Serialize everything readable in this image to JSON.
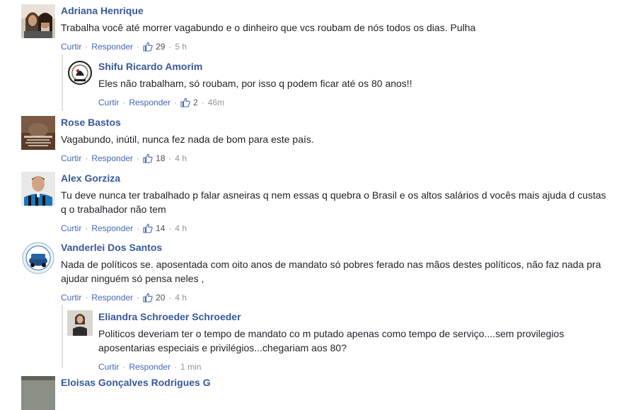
{
  "actions": {
    "like": "Curtir",
    "reply": "Responder",
    "sep": "·"
  },
  "comments": [
    {
      "name": "Adriana Henrique",
      "text": "Trabalha você até morrer vagabundo e o dinheiro que vcs roubam de nós todos os dias. Pulha",
      "likes": "29",
      "time": "5 h"
    },
    {
      "name": "Shifu Ricardo Amorim",
      "text": "Eles não trabalham, só roubam, por isso q podem ficar até os 80 anos!!",
      "likes": "2",
      "time": "46m"
    },
    {
      "name": "Rose Bastos",
      "text": "Vagabundo, inútil, nunca fez nada de bom para este país.",
      "likes": "18",
      "time": "4 h"
    },
    {
      "name": "Alex Gorziza",
      "text": "Tu deve nunca ter trabalhado p falar asneiras q nem essas q quebra o Brasil e os altos salários d vocês mais ajuda d custas q o trabalhador não tem",
      "likes": "14",
      "time": "4 h"
    },
    {
      "name": "Vanderlei Dos Santos",
      "text": "Nada de políticos se. aposentada com oito anos de mandato só pobres ferado nas mãos destes políticos, não faz nada pra ajudar ninguém só pensa neles ,",
      "likes": "20",
      "time": "4 h"
    },
    {
      "name": "Eliandra Schroeder Schroeder",
      "text": "Politicos deveriam ter o tempo de mandato co m putado apenas como tempo de serviço....sem provilegios aposentarias especiais e privilégios...chegariam aos 80?",
      "time": "1 min"
    },
    {
      "name": "Eloisas Gonçalves Rodrigues G"
    }
  ],
  "colors": {
    "name": "#365899",
    "link": "#4267b2",
    "meta": "#90949c",
    "text": "#1d2129"
  },
  "icons": {
    "like": "thumbs-up-icon"
  }
}
